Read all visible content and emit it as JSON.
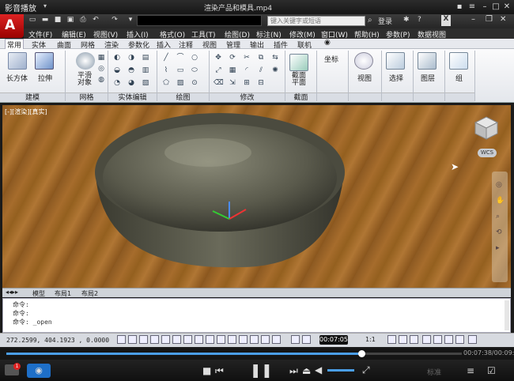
{
  "player": {
    "app_name": "影音播放",
    "file_title": "渲染产品和模具.mp4",
    "time_tooltip": "00:07:05",
    "time_display": "00:07:38/00:09:33",
    "progress": 0.78,
    "quality_label": "标准",
    "play_state": "paused"
  },
  "acad": {
    "search_placeholder": "键入关键字或短语",
    "login_label": "登录",
    "app_button": "A"
  },
  "menubar": [
    "文件(F)",
    "编辑(E)",
    "视图(V)",
    "插入(I)",
    "格式(O)",
    "工具(T)",
    "绘图(D)",
    "标注(N)",
    "修改(M)",
    "窗口(W)",
    "帮助(H)",
    "参数(P)",
    "数据视图"
  ],
  "ribbon_tabs": [
    "常用",
    "实体",
    "曲面",
    "网格",
    "渲染",
    "参数化",
    "插入",
    "注释",
    "视图",
    "管理",
    "输出",
    "插件",
    "联机"
  ],
  "active_tab": "常用",
  "ribbon": {
    "big_buttons": {
      "box": "长方体",
      "extrude": "拉伸",
      "smooth": "平滑对象",
      "section": "截面平面",
      "view": "视图",
      "select": "选择",
      "layers": "图层",
      "group": "组",
      "coords": "坐标"
    },
    "panels": [
      "建模",
      "网格",
      "实体编辑",
      "绘图",
      "修改",
      "截面",
      "视图",
      "选择",
      "图层",
      "组"
    ]
  },
  "viewport": {
    "label": "[-][渲染][真实]",
    "wcs": "WCS"
  },
  "layout_tabs": [
    "模型",
    "布局1",
    "布局2"
  ],
  "command_lines": [
    "命令:",
    "命令:",
    "命令: _open"
  ],
  "status": {
    "coords": "272.2599, 404.1923 , 0.0000",
    "scale": "1:1"
  }
}
